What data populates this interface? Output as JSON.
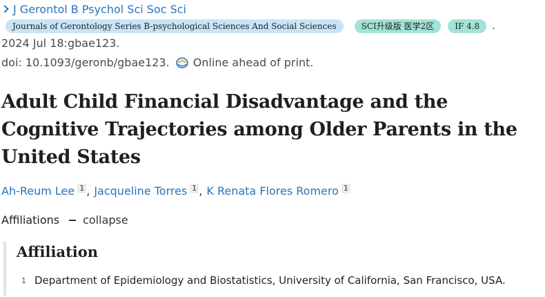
{
  "journal": {
    "abbrev": "J Gerontol B Psychol Sci Soc Sci",
    "full_name": "Journals of Gerontology Series B-psychological Sciences And Social Sciences",
    "sci_badge": "SCI升级版 医学2区",
    "if_badge": "IF 4.8",
    "trailing": "."
  },
  "publication": {
    "date_line": "2024 Jul 18:gbae123.",
    "doi": "doi: 10.1093/geronb/gbae123.",
    "status": "Online ahead of print."
  },
  "article": {
    "title": "Adult Child Financial Disadvantage and the Cognitive Trajectories among Older Parents in the United States"
  },
  "authors": [
    {
      "name": "Ah-Reum Lee",
      "affil": "1"
    },
    {
      "name": "Jacqueline Torres",
      "affil": "1"
    },
    {
      "name": "K Renata Flores Romero",
      "affil": "1"
    }
  ],
  "affiliations": {
    "toggle_label": "Affiliations",
    "collapse_label": "collapse",
    "heading": "Affiliation",
    "items": [
      {
        "num": "1",
        "text": "Department of Epidemiology and Biostatistics, University of California, San Francisco, USA."
      }
    ]
  },
  "colors": {
    "link": "#2a73b8",
    "journal_badge": "#c8e4f7",
    "metric_badge": "#a2e3d8"
  },
  "icons": [
    "chevron-right-icon",
    "online-ahead-icon",
    "minus-icon"
  ]
}
